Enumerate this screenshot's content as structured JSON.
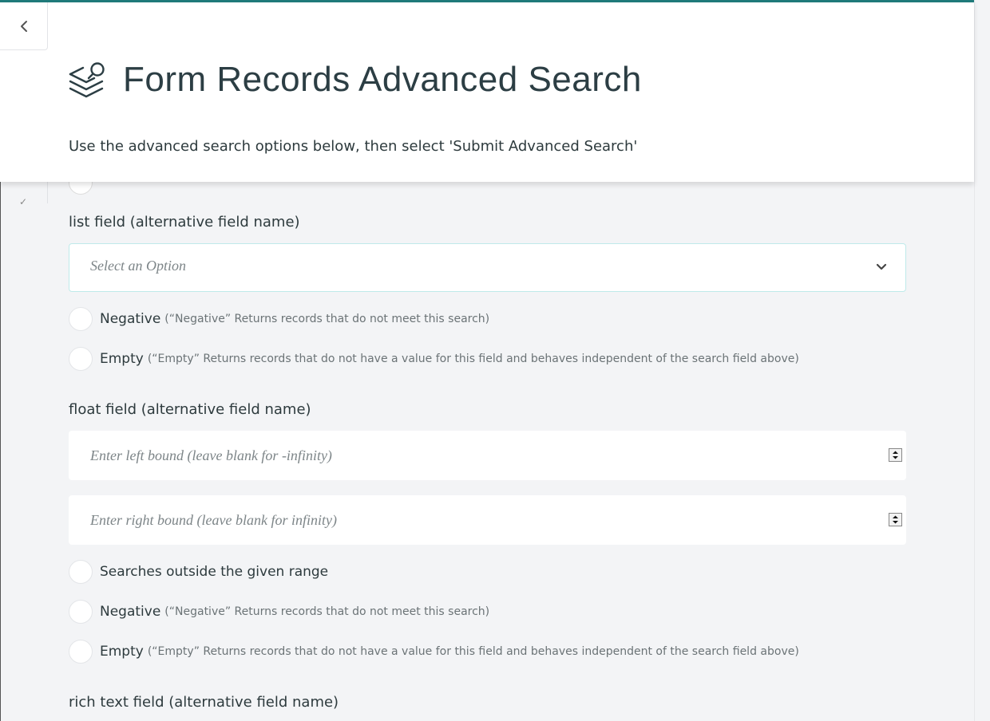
{
  "header": {
    "back_icon": "chevron-left-icon",
    "title_icon": "layers-search-icon",
    "title": "Form Records Advanced Search",
    "subtitle": "Use the advanced search options below, then select 'Submit Advanced Search'"
  },
  "list_field": {
    "label": "list field (alternative field name)",
    "select_placeholder": "Select an Option",
    "negative_label": "Negative",
    "negative_hint": "(“Negative” Returns records that do not meet this search)",
    "empty_label": "Empty",
    "empty_hint": "(“Empty” Returns records that do not have a value for this field and behaves independent of the search field above)"
  },
  "float_field": {
    "label": "float field (alternative field name)",
    "left_bound_placeholder": "Enter left bound (leave blank for -infinity)",
    "right_bound_placeholder": "Enter right bound (leave blank for infinity)",
    "outside_range_label": "Searches outside the given range",
    "negative_label": "Negative",
    "negative_hint": "(“Negative” Returns records that do not meet this search)",
    "empty_label": "Empty",
    "empty_hint": "(“Empty” Returns records that do not have a value for this field and behaves independent of the search field above)"
  },
  "rich_text_field": {
    "label": "rich text field (alternative field name)"
  },
  "colors": {
    "accent": "#1f7a7a",
    "select_border": "#bfeaea",
    "page_background": "#f3f4f6"
  }
}
